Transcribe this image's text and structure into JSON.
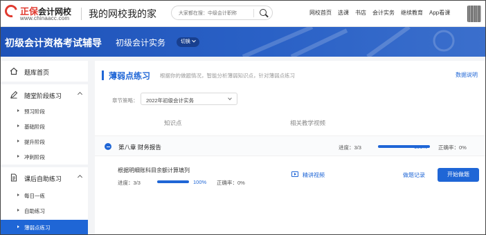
{
  "header": {
    "brand_name": "正保",
    "brand_sub": "会计网校",
    "brand_url": "www.chinaacc.com",
    "site_title": "我的网校我的家",
    "search": {
      "placeholder": "大家都在搜：中级会计职称",
      "icon": "search-icon"
    },
    "nav": [
      "网校首页",
      "选课",
      "书店",
      "会计实务",
      "继续教育",
      "App看课"
    ]
  },
  "banner": {
    "title": "初级会计资格考试辅导",
    "subtitle": "初级会计实务",
    "switch_label": "切换"
  },
  "sidebar": {
    "home": {
      "label": "题库首页",
      "icon": "home-icon"
    },
    "groups": [
      {
        "label": "随堂阶段练习",
        "icon": "pen-icon",
        "items": [
          "预习阶段",
          "基础阶段",
          "提升阶段",
          "冲刺阶段"
        ]
      },
      {
        "label": "课后自助练习",
        "icon": "document-icon",
        "items": [
          "每日一练",
          "自助练习",
          "薄弱点练习"
        ]
      }
    ],
    "active_item": "薄弱点练习"
  },
  "main": {
    "title": "薄弱点练习",
    "description": "根据你的做题情况，智能分析薄弱知识点，针对薄弱点练习",
    "data_link": "数据说明",
    "chapter_filter": {
      "label": "章节策略：",
      "value": "2022年初级会计实务"
    },
    "columns": [
      "知识点",
      "相关教学视频"
    ],
    "chapter": {
      "name": "第八章  财务报告",
      "progress_label": "进度：3/3",
      "progress": 1.0,
      "progress_pct": "100%",
      "accuracy": "正确率：0%"
    },
    "knowledge_point": {
      "title": "根据明细账科目余额计算填列",
      "progress_label": "进度：3/3",
      "progress": 1.0,
      "progress_pct": "100%",
      "accuracy": "正确率：0%",
      "video_link": "精讲视频",
      "record_link": "做题记录",
      "start_button": "开始做题"
    }
  }
}
